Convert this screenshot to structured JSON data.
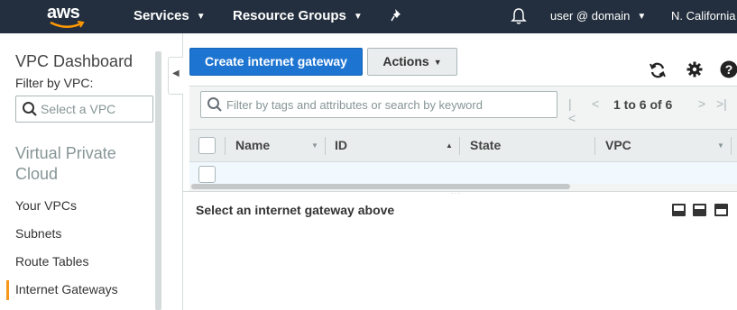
{
  "topbar": {
    "logo": "aws",
    "services": "Services",
    "resource_groups": "Resource Groups",
    "user": "user @ domain",
    "region": "N. California"
  },
  "sidebar": {
    "title": "VPC Dashboard",
    "filter_label": "Filter by VPC:",
    "filter_placeholder": "Select a VPC",
    "section": "Virtual Private Cloud",
    "items": [
      {
        "label": "Your VPCs",
        "active": false
      },
      {
        "label": "Subnets",
        "active": false
      },
      {
        "label": "Route Tables",
        "active": false
      },
      {
        "label": "Internet Gateways",
        "active": true
      }
    ]
  },
  "toolbar": {
    "create_label": "Create internet gateway",
    "actions_label": "Actions"
  },
  "search": {
    "placeholder": "Filter by tags and attributes or search by keyword"
  },
  "pagination": {
    "text": "1 to 6 of 6"
  },
  "table": {
    "columns": [
      "Name",
      "ID",
      "State",
      "VPC"
    ]
  },
  "detail": {
    "message": "Select an internet gateway above"
  },
  "colors": {
    "nav_bg": "#232f3e",
    "primary": "#1d74d1",
    "active_accent": "#f7981d"
  }
}
